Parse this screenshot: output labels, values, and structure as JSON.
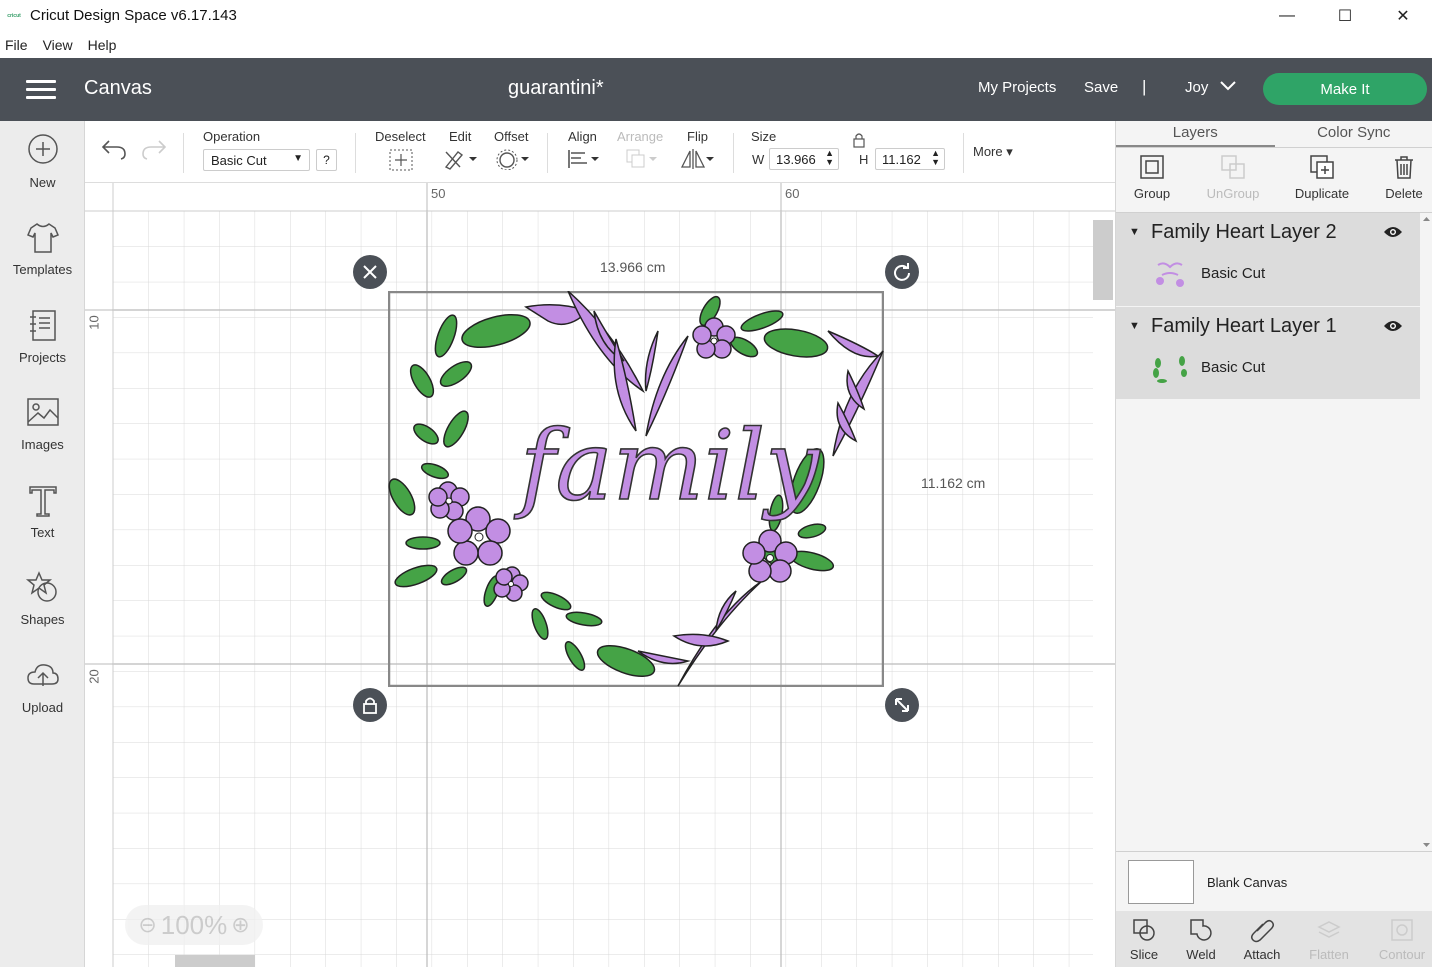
{
  "window": {
    "app_logo_text": "cricut",
    "title": "Cricut Design Space  v6.17.143",
    "controls": {
      "minimize": "—",
      "maximize": "☐",
      "close": "✕"
    }
  },
  "menu": {
    "file": "File",
    "view": "View",
    "help": "Help"
  },
  "header": {
    "section": "Canvas",
    "project_name": "guarantini*",
    "my_projects": "My Projects",
    "save": "Save",
    "separator": "|",
    "user": "Joy",
    "make_it": "Make It"
  },
  "left_nav": {
    "new": "New",
    "templates": "Templates",
    "projects": "Projects",
    "images": "Images",
    "text": "Text",
    "shapes": "Shapes",
    "upload": "Upload"
  },
  "toolbar": {
    "operation_label": "Operation",
    "operation_value": "Basic Cut",
    "help": "?",
    "deselect": "Deselect",
    "edit": "Edit",
    "offset": "Offset",
    "align": "Align",
    "arrange": "Arrange",
    "flip": "Flip",
    "size_label": "Size",
    "w_label": "W",
    "w_value": "13.966",
    "h_label": "H",
    "h_value": "11.162",
    "more": "More"
  },
  "canvas": {
    "ruler_top": [
      "50",
      "60"
    ],
    "ruler_left": [
      "10",
      "20"
    ],
    "width_label": "13.966 cm",
    "height_label": "11.162 cm",
    "design_text": "family",
    "zoom": "100%"
  },
  "right_panel": {
    "tabs": {
      "layers": "Layers",
      "color_sync": "Color Sync"
    },
    "actions": {
      "group": "Group",
      "ungroup": "UnGroup",
      "duplicate": "Duplicate",
      "delete": "Delete"
    },
    "layers": [
      {
        "name": "Family Heart Layer 2",
        "sub": "Basic Cut"
      },
      {
        "name": "Family Heart Layer 1",
        "sub": "Basic Cut"
      }
    ],
    "blank_canvas": "Blank Canvas",
    "bottom_actions": {
      "slice": "Slice",
      "weld": "Weld",
      "attach": "Attach",
      "flatten": "Flatten",
      "contour": "Contour"
    }
  },
  "colors": {
    "header_bg": "#4b5057",
    "make_it": "#2fa467",
    "purple": "#c28ee3",
    "green": "#45a346"
  }
}
